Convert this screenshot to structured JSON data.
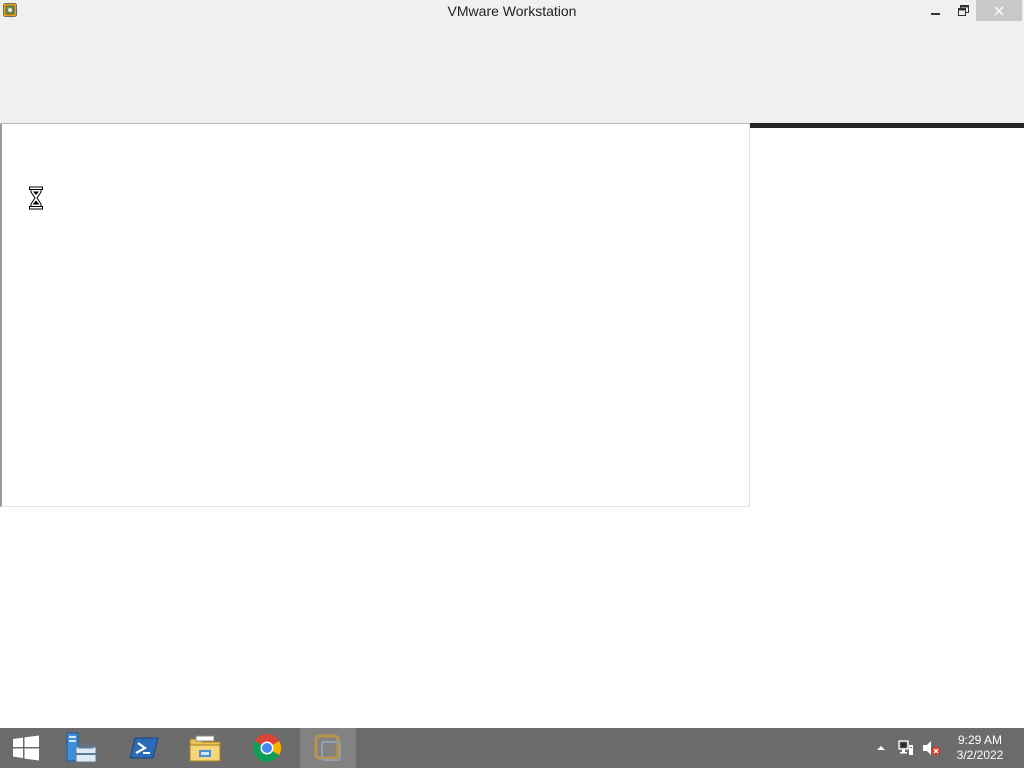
{
  "window": {
    "title": "VMware Workstation",
    "app_icon": "vmware-icon",
    "controls": {
      "minimize_icon": "minimize-icon",
      "maximize_icon": "restore-icon",
      "close_icon": "close-icon"
    }
  },
  "content": {
    "cursor_icon": "hourglass-busy-icon"
  },
  "taskbar": {
    "items": [
      {
        "icon": "windows-start-icon"
      },
      {
        "icon": "server-manager-icon"
      },
      {
        "icon": "powershell-icon"
      },
      {
        "icon": "file-explorer-icon"
      },
      {
        "icon": "chrome-icon"
      },
      {
        "icon": "vmware-workstation-icon",
        "active": true
      }
    ],
    "tray": {
      "icons": [
        "show-hidden-icons-chevron",
        "network-icon",
        "volume-muted-icon"
      ],
      "time": "9:29 AM",
      "date": "3/2/2022"
    }
  },
  "colors": {
    "titlebar_bg": "#f0f0f0",
    "taskbar_bg": "#6c6c6c",
    "taskbar_active_bg": "#828282",
    "close_hover": "#c8c8c8",
    "dark_bar": "#262626"
  }
}
